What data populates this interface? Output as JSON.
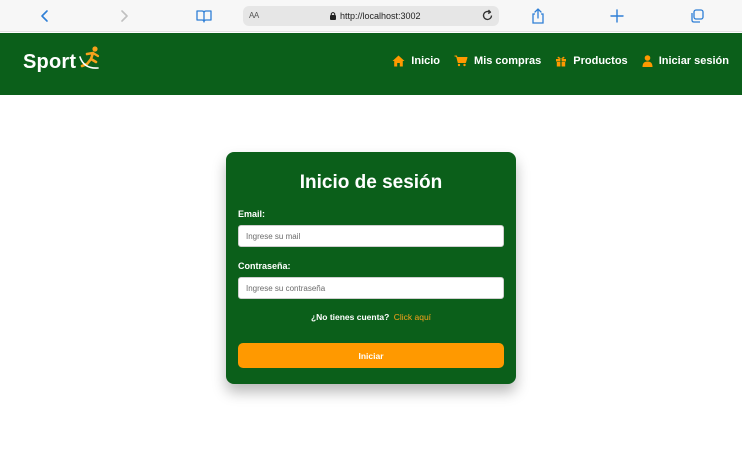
{
  "browser": {
    "address_aa": "AA",
    "url": "http://localhost:3002",
    "icons": [
      "back-icon",
      "forward-icon",
      "book-icon",
      "lock-icon",
      "reload-icon",
      "share-icon",
      "plus-icon",
      "tabs-icon"
    ]
  },
  "header": {
    "brand": "Sport",
    "nav": [
      {
        "label": "Inicio",
        "icon": "home-icon"
      },
      {
        "label": "Mis compras",
        "icon": "cart-icon"
      },
      {
        "label": "Productos",
        "icon": "gift-icon"
      },
      {
        "label": "Iniciar sesión",
        "icon": "user-icon"
      }
    ]
  },
  "login": {
    "title": "Inicio de sesión",
    "email_label": "Email:",
    "email_placeholder": "Ingrese su mail",
    "email_value": "",
    "password_label": "Contraseña:",
    "password_placeholder": "Ingrese su contraseña",
    "password_value": "",
    "register_prompt": "¿No tienes cuenta?",
    "register_link": "Click aquí",
    "submit_label": "Iniciar"
  },
  "colors": {
    "header_green": "#0b5f1a",
    "accent_orange": "#ff9900",
    "link_orange": "#f7a21b"
  }
}
